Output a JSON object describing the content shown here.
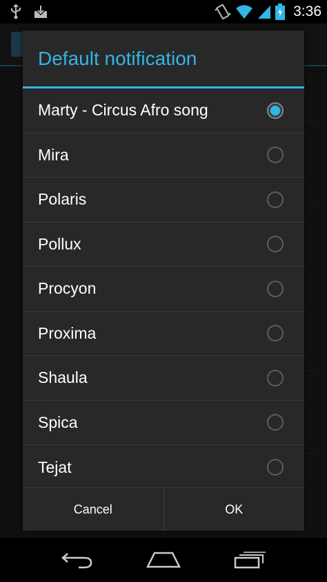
{
  "status_bar": {
    "time": "3:36",
    "icons": [
      "usb-icon",
      "download-icon",
      "vibrate-icon",
      "wifi-icon",
      "signal-icon",
      "battery-charging-icon"
    ]
  },
  "dialog": {
    "title": "Default notification",
    "selected": "Marty - Circus Afro song",
    "options": [
      {
        "label": "Marty - Circus Afro song",
        "checked": true
      },
      {
        "label": "Mira",
        "checked": false
      },
      {
        "label": "Polaris",
        "checked": false
      },
      {
        "label": "Pollux",
        "checked": false
      },
      {
        "label": "Procyon",
        "checked": false
      },
      {
        "label": "Proxima",
        "checked": false
      },
      {
        "label": "Shaula",
        "checked": false
      },
      {
        "label": "Spica",
        "checked": false
      },
      {
        "label": "Tejat",
        "checked": false
      }
    ],
    "buttons": {
      "cancel": "Cancel",
      "ok": "OK"
    }
  },
  "nav_bar": {
    "icons": [
      "back-icon",
      "home-icon",
      "recent-apps-icon"
    ]
  },
  "colors": {
    "accent": "#33b5e5",
    "dialog_bg": "#282828",
    "divider": "#3a3a3a"
  }
}
